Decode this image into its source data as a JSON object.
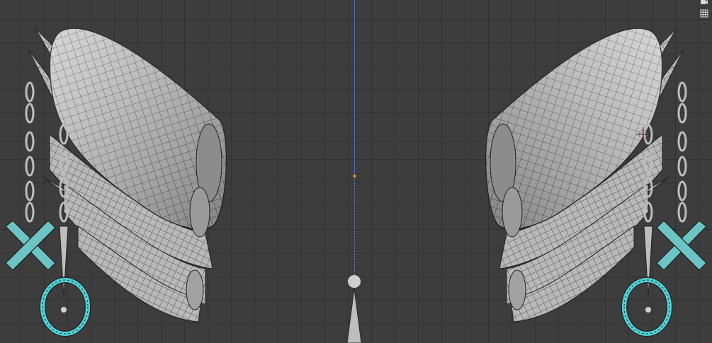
{
  "viewport": {
    "colors": {
      "background": "#3d3d3d",
      "grid_line": "#333333",
      "axis_line": "#4f6fae",
      "mesh_fill": "#c9c9c9",
      "mesh_wire": "#2c2c2c",
      "selection": "#4fd4d8",
      "origin": "#e89b2a"
    },
    "header_icons": [
      "camera-view-icon",
      "grid-view-icon"
    ]
  }
}
